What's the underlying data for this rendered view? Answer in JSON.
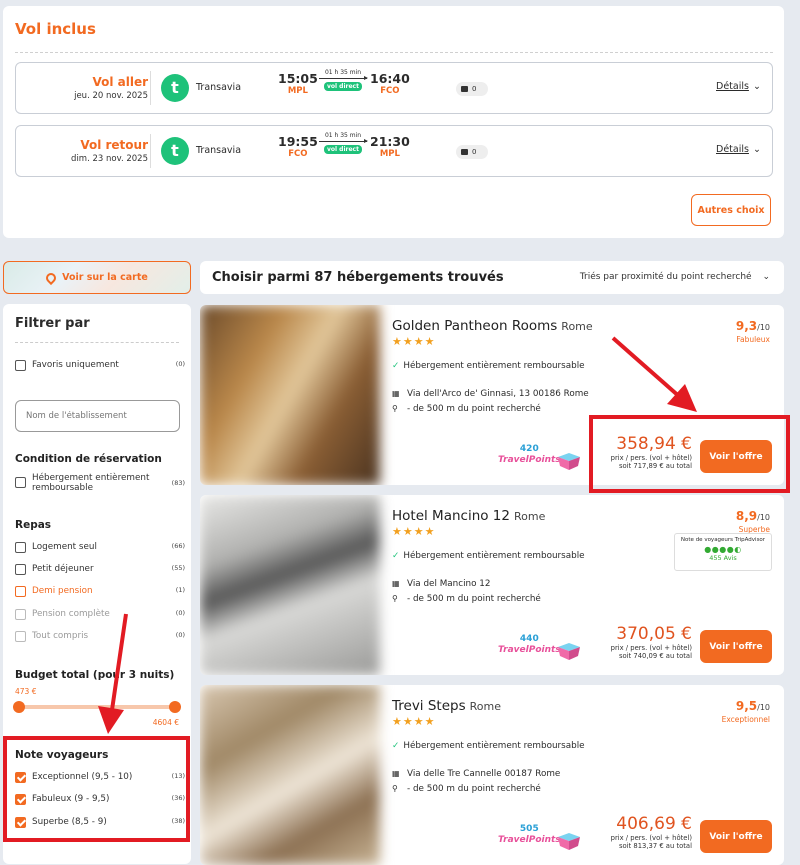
{
  "vol": {
    "title": "Vol inclus",
    "flights": [
      {
        "label": "Vol aller",
        "date": "jeu. 20 nov. 2025",
        "airline": "Transavia",
        "dep_time": "15:05",
        "dep_code": "MPL",
        "duration": "01 h 35 min",
        "direct": "vol direct",
        "arr_time": "16:40",
        "arr_code": "FCO",
        "bags": "0",
        "details": "Détails"
      },
      {
        "label": "Vol retour",
        "date": "dim. 23 nov. 2025",
        "airline": "Transavia",
        "dep_time": "19:55",
        "dep_code": "FCO",
        "duration": "01 h 35 min",
        "direct": "vol direct",
        "arr_time": "21:30",
        "arr_code": "MPL",
        "bags": "0",
        "details": "Détails"
      }
    ],
    "autres": "Autres choix"
  },
  "map_button": "Voir sur la carte",
  "results": {
    "heading": "Choisir parmi 87 hébergements trouvés",
    "sort": "Triés par proximité du point recherché"
  },
  "filter": {
    "title": "Filtrer par",
    "favoris": {
      "label": "Favoris uniquement",
      "count": "(0)"
    },
    "name_placeholder": "Nom de l'établissement",
    "condition_title": "Condition de réservation",
    "condition": {
      "label": "Hébergement entièrement remboursable",
      "count": "(83)"
    },
    "repas_title": "Repas",
    "repas": [
      {
        "label": "Logement seul",
        "count": "(66)"
      },
      {
        "label": "Petit déjeuner",
        "count": "(55)"
      },
      {
        "label": "Demi pension",
        "count": "(1)"
      },
      {
        "label": "Pension complète",
        "count": "(0)"
      },
      {
        "label": "Tout compris",
        "count": "(0)"
      }
    ],
    "budget_title": "Budget total (pour 3 nuits)",
    "budget_min": "473 €",
    "budget_max": "4604 €",
    "note_title": "Note voyageurs",
    "notes": [
      {
        "label": "Exceptionnel (9,5 - 10)",
        "count": "(13)"
      },
      {
        "label": "Fabuleux (9 - 9,5)",
        "count": "(36)"
      },
      {
        "label": "Superbe (8,5 - 9)",
        "count": "(38)"
      }
    ]
  },
  "hotels": [
    {
      "name": "Golden Pantheon Rooms",
      "city": "Rome",
      "stars": "★★★★",
      "score": "9,3",
      "max": "/10",
      "word": "Fabuleux",
      "refund": "Hébergement entièrement remboursable",
      "address": "Via dell'Arco de' Ginnasi, 13 00186 Rome",
      "distance": "- de 500 m du point recherché",
      "points": "420",
      "points_label": "TravelPoints",
      "price": "358,94 €",
      "per": "prix / pers. (vol + hôtel)",
      "total": "soit 717,89 € au total",
      "button": "Voir l'offre"
    },
    {
      "name": "Hotel Mancino 12",
      "city": "Rome",
      "stars": "★★★★",
      "score": "8,9",
      "max": "/10",
      "word": "Superbe",
      "refund": "Hébergement entièrement remboursable",
      "address": "Via del Mancino 12",
      "distance": "- de 500 m du point recherché",
      "points": "440",
      "points_label": "TravelPoints",
      "price": "370,05 €",
      "per": "prix / pers. (vol + hôtel)",
      "total": "soit 740,09 € au total",
      "button": "Voir l'offre",
      "tripadvisor": {
        "title": "Note de voyageurs TripAdvisor",
        "reviews": "455 Avis"
      }
    },
    {
      "name": "Trevi Steps",
      "city": "Rome",
      "stars": "★★★★",
      "score": "9,5",
      "max": "/10",
      "word": "Exceptionnel",
      "refund": "Hébergement entièrement remboursable",
      "address": "Via delle Tre Cannelle 00187 Rome",
      "distance": "- de 500 m du point recherché",
      "points": "505",
      "points_label": "TravelPoints",
      "price": "406,69 €",
      "per": "prix / pers. (vol + hôtel)",
      "total": "soit 813,37 € au total",
      "button": "Voir l'offre"
    }
  ],
  "colors": {
    "accent": "#f26a21",
    "green": "#1ec27a",
    "annotation": "#e21b23"
  }
}
